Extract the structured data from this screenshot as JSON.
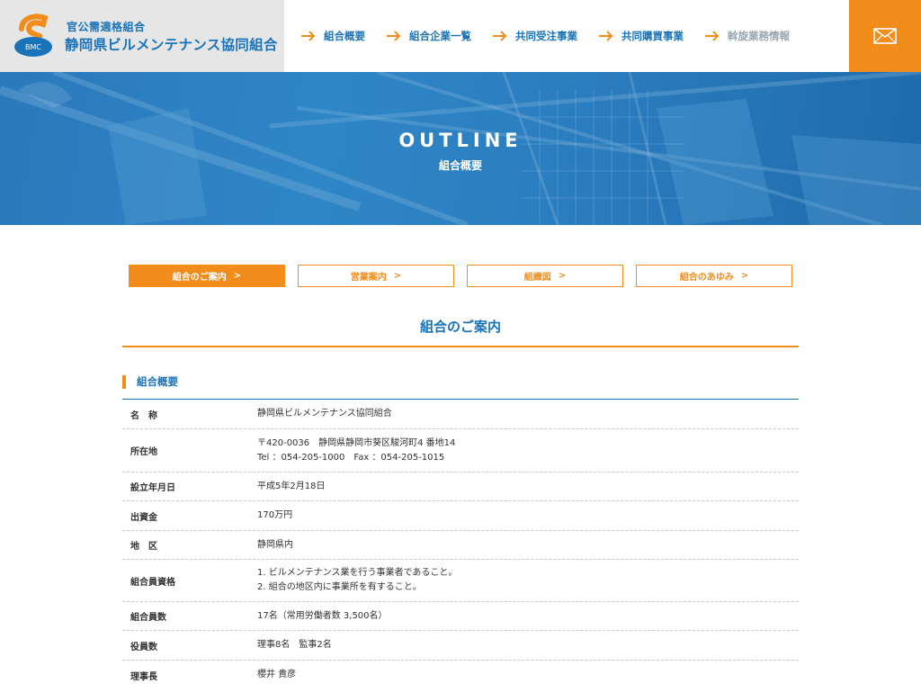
{
  "header": {
    "logo_sub": "官公需適格組合",
    "logo_main": "静岡県ビルメンテナンス協同組合",
    "logo_badge": "BMC",
    "nav": [
      {
        "label": "組合概要",
        "muted": false
      },
      {
        "label": "組合企業一覧",
        "muted": false
      },
      {
        "label": "共同受注事業",
        "muted": false
      },
      {
        "label": "共同購買事業",
        "muted": false
      },
      {
        "label": "斡旋業務情報",
        "muted": true
      }
    ],
    "mail_icon": "envelope-icon"
  },
  "hero": {
    "title": "OUTLINE",
    "subtitle": "組合概要"
  },
  "subtabs": [
    {
      "label": "組合のご案内",
      "active": true
    },
    {
      "label": "営業案内",
      "active": false
    },
    {
      "label": "組織図",
      "active": false
    },
    {
      "label": "組合のあゆみ",
      "active": false
    }
  ],
  "subtab_chevron": ">",
  "section_title": "組合のご案内",
  "overview": {
    "heading": "組合概要",
    "rows": [
      {
        "key": "名　称",
        "lines": [
          "静岡県ビルメンテナンス協同組合"
        ]
      },
      {
        "key": "所在地",
        "lines": [
          "〒420-0036　静岡県静岡市葵区駿河町4 番地14",
          "Tel ：054-205-1000　Fax ：054-205-1015"
        ]
      },
      {
        "key": "設立年月日",
        "lines": [
          "平成5年2月18日"
        ]
      },
      {
        "key": "出資金",
        "lines": [
          "170万円"
        ]
      },
      {
        "key": "地　区",
        "lines": [
          "静岡県内"
        ]
      },
      {
        "key": "組合員資格",
        "lines": [
          "1. ビルメンテナンス業を行う事業者であること。",
          "2. 組合の地区内に事業所を有すること。"
        ]
      },
      {
        "key": "組合員数",
        "lines": [
          "17名（常用労働者数 3,500名）"
        ]
      },
      {
        "key": "役員数",
        "lines": [
          "理事8名　監事2名"
        ]
      },
      {
        "key": "理事長",
        "lines": [
          "櫻井 貴彦"
        ]
      }
    ]
  },
  "colors": {
    "brand_blue": "#1a73b8",
    "accent_orange": "#f28c1a"
  }
}
